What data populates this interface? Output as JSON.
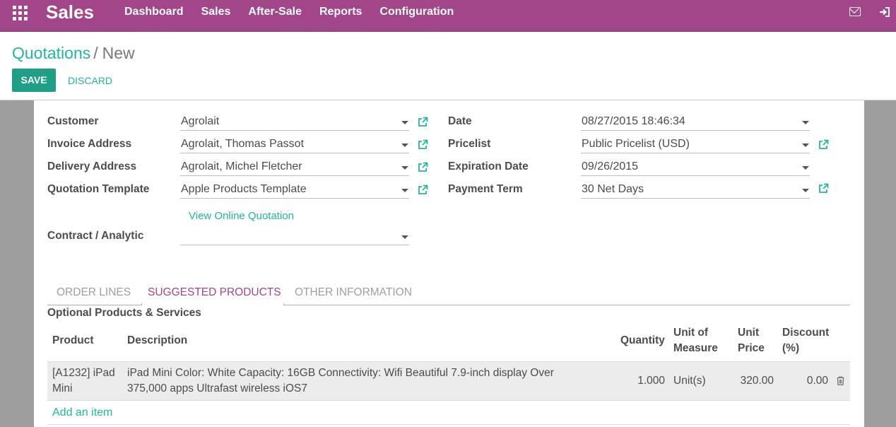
{
  "app": {
    "name": "Sales",
    "menu": [
      "Dashboard",
      "Sales",
      "After-Sale",
      "Reports",
      "Configuration"
    ]
  },
  "breadcrumb": {
    "parent": "Quotations",
    "separator": "/",
    "current": "New"
  },
  "buttons": {
    "save": "SAVE",
    "discard": "DISCARD"
  },
  "form": {
    "left": [
      {
        "label": "Customer",
        "value": "Agrolait"
      },
      {
        "label": "Invoice Address",
        "value": "Agrolait, Thomas Passot"
      },
      {
        "label": "Delivery Address",
        "value": "Agrolait, Michel Fletcher"
      },
      {
        "label": "Quotation Template",
        "value": "Apple Products Template"
      }
    ],
    "online_link": "View Online Quotation",
    "contract": {
      "label": "Contract / Analytic",
      "value": ""
    },
    "right": [
      {
        "label": "Date",
        "value": "08/27/2015 18:46:34"
      },
      {
        "label": "Pricelist",
        "value": "Public Pricelist (USD)"
      },
      {
        "label": "Expiration Date",
        "value": "09/26/2015"
      },
      {
        "label": "Payment Term",
        "value": "30 Net Days"
      }
    ]
  },
  "tabs": [
    "ORDER LINES",
    "SUGGESTED PRODUCTS",
    "OTHER INFORMATION"
  ],
  "active_tab": "SUGGESTED PRODUCTS",
  "section_title": "Optional Products & Services",
  "table": {
    "headers": {
      "product": "Product",
      "description": "Description",
      "quantity": "Quantity",
      "uom_line1": "Unit of",
      "uom_line2": "Measure",
      "price_line1": "Unit",
      "price_line2": "Price",
      "discount_line1": "Discount",
      "discount_line2": "(%)"
    },
    "rows": [
      {
        "product_line1": "[A1232] iPad",
        "product_line2": "Mini",
        "description_line1": "iPad Mini Color: White Capacity: 16GB Connectivity: Wifi Beautiful 7.9-inch display Over",
        "description_line2": "375,000 apps Ultrafast wireless iOS7",
        "quantity": "1.000",
        "uom": "Unit(s)",
        "unit_price": "320.00",
        "discount": "0.00"
      }
    ],
    "add_item": "Add an item"
  },
  "colors": {
    "brand": "#a24689",
    "accent": "#21b799",
    "save_button": "#1f9f86"
  },
  "icons": [
    "apps-grid-icon",
    "mail-icon",
    "logout-icon",
    "external-link-icon",
    "dropdown-caret-icon",
    "trash-icon"
  ]
}
